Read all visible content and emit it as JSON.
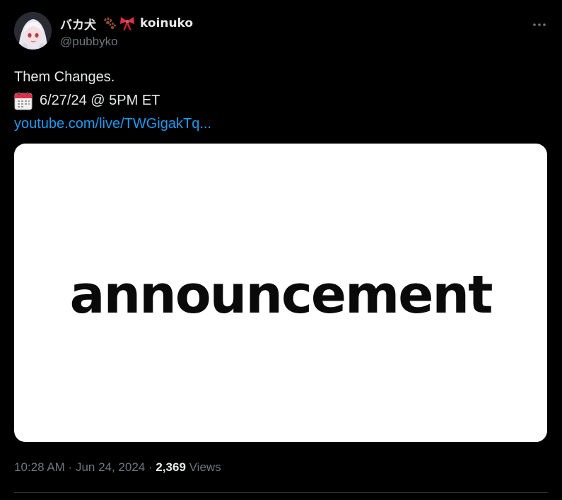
{
  "author": {
    "display_name": "バカ犬",
    "display_name_suffix": "koinuko",
    "name_emojis": [
      "paw-prints-icon",
      "ribbon-icon"
    ],
    "handle": "@pubbyko",
    "avatar": "avatar-icon"
  },
  "tweet": {
    "line1": "Them Changes.",
    "date_icon": "calendar-icon",
    "line2": "6/27/24 @ 5PM ET",
    "link_text": "youtube.com/live/TWGigakTq..."
  },
  "media": {
    "headline": "announcement"
  },
  "meta": {
    "time": "10:28 AM",
    "separator": " · ",
    "date": "Jun 24, 2024",
    "views_count": "2,369",
    "views_label": "Views"
  },
  "colors": {
    "background": "#000000",
    "text": "#e7e9ea",
    "muted": "#71767b",
    "link": "#1d9bf0",
    "divider": "#2f3336"
  },
  "more_icon": "more-horizontal-icon"
}
